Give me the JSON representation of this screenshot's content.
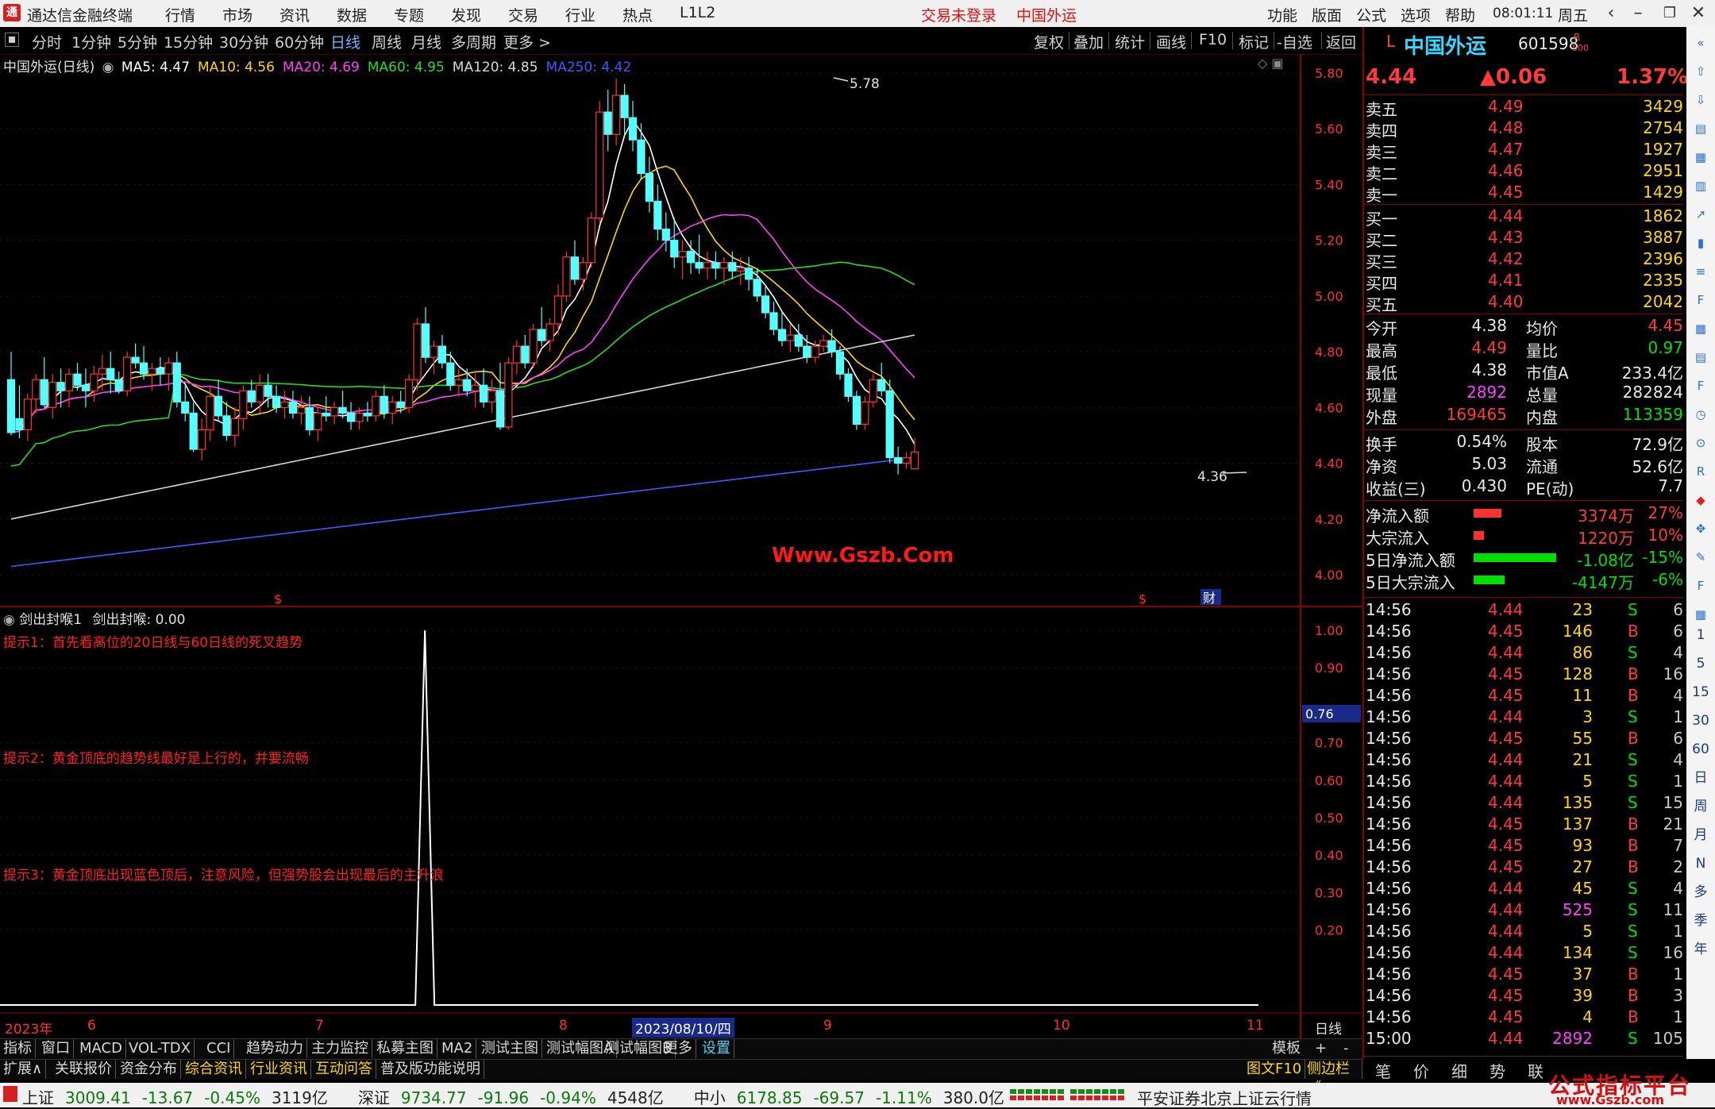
{
  "app": {
    "title": "通达信金融终端",
    "menu": [
      "行情",
      "市场",
      "资讯",
      "数据",
      "专题",
      "发现",
      "交易",
      "行业",
      "热点",
      "L1L2"
    ],
    "login_status": "交易未登录",
    "stock_title": "中国外运",
    "right_menu": [
      "功能",
      "版面",
      "公式",
      "选项",
      "帮助"
    ],
    "clock": "08:01:11",
    "weekday": "周五"
  },
  "period_bar": {
    "items": [
      "分时",
      "1分钟",
      "5分钟",
      "15分钟",
      "30分钟",
      "60分钟",
      "日线",
      "周线",
      "月线",
      "多周期",
      "更多 >"
    ],
    "selected": "日线",
    "tools": [
      "复权",
      "叠加",
      "统计",
      "画线",
      "F10",
      "标记",
      "-自选",
      "返回"
    ]
  },
  "chart_header": {
    "name": "中国外运(日线)",
    "ma": [
      {
        "label": "MA5: 4.47",
        "color": "#ffffff"
      },
      {
        "label": "MA10: 4.56",
        "color": "#ffd800"
      },
      {
        "label": "MA20: 4.69",
        "color": "#ff40ff"
      },
      {
        "label": "MA60: 4.95",
        "color": "#22dd22"
      },
      {
        "label": "MA120: 4.85",
        "color": "#d8d8d8"
      },
      {
        "label": "MA250: 4.42",
        "color": "#3c5cff"
      }
    ],
    "high_marker": "5.78",
    "low_marker": "4.36",
    "watermark": "Www.Gszb.Com",
    "markers": [
      "$",
      "$",
      "财"
    ]
  },
  "price_axis": [
    "5.80",
    "5.60",
    "5.40",
    "5.20",
    "5.00",
    "4.80",
    "4.60",
    "4.40",
    "4.20",
    "4.00"
  ],
  "indicator": {
    "name": "剑出封喉1",
    "value_label": "剑出封喉: 0.00",
    "axis": [
      "1.00",
      "0.90",
      "0.70",
      "0.60",
      "0.50",
      "0.40",
      "0.30",
      "0.20"
    ],
    "current_tag": "0.76",
    "hints": [
      "提示1：首先看高位的20日线与60日线的死叉趋势",
      "提示2：黄金顶底的趋势线最好是上行的，并要流畅",
      "提示3：黄金顶底出现蓝色顶后，注意风险，但强势股会出现最后的主升浪"
    ]
  },
  "date_axis": {
    "labels": [
      "2023年",
      "6",
      "7",
      "8",
      "9",
      "10",
      "11"
    ],
    "cursor": "2023/08/10/四",
    "period": "日线"
  },
  "bottom_tabs": [
    "指标",
    "窗口",
    "MACD",
    "VOL-TDX",
    "CCI",
    "趋势动力",
    "主力监控",
    "私募主图",
    "MA2",
    "测试主图",
    "测试幅图A",
    "测试幅图B",
    "更多",
    "设置"
  ],
  "bottom_tabs_right": [
    "模板",
    "+",
    "-"
  ],
  "bottom_links": [
    {
      "label": "扩展∧",
      "color": "#d8d8d8"
    },
    {
      "label": "关联报价",
      "color": "#d8d8d8"
    },
    {
      "label": "资金分布",
      "color": "#d8d8d8"
    },
    {
      "label": "综合资讯",
      "color": "#ffd800"
    },
    {
      "label": "行业资讯",
      "color": "#ffd800"
    },
    {
      "label": "互动问答",
      "color": "#ffd800"
    },
    {
      "label": "普及版功能说明",
      "color": "#d8d8d8"
    }
  ],
  "bottom_right_links": [
    "图文F10",
    "侧边栏 《"
  ],
  "quote": {
    "code_prefix": "L",
    "name": "中国外运",
    "code": "601598",
    "code_suffix": "R",
    "code_sub": "500",
    "price": "4.44",
    "change": "▲0.06",
    "change_pct": "1.37%",
    "asks": [
      {
        "label": "卖五",
        "price": "4.49",
        "vol": "3429"
      },
      {
        "label": "卖四",
        "price": "4.48",
        "vol": "2754"
      },
      {
        "label": "卖三",
        "price": "4.47",
        "vol": "1927"
      },
      {
        "label": "卖二",
        "price": "4.46",
        "vol": "2951"
      },
      {
        "label": "卖一",
        "price": "4.45",
        "vol": "1429"
      }
    ],
    "bids": [
      {
        "label": "买一",
        "price": "4.44",
        "vol": "1862"
      },
      {
        "label": "买二",
        "price": "4.43",
        "vol": "3887"
      },
      {
        "label": "买三",
        "price": "4.42",
        "vol": "2396"
      },
      {
        "label": "买四",
        "price": "4.41",
        "vol": "2335"
      },
      {
        "label": "买五",
        "price": "4.40",
        "vol": "2042"
      }
    ],
    "stats": [
      {
        "l1": "今开",
        "v1": "4.38",
        "c1": "#e8e8e8",
        "l2": "均价",
        "v2": "4.45",
        "c2": "#ff3b3b"
      },
      {
        "l1": "最高",
        "v1": "4.49",
        "c1": "#ff3b3b",
        "l2": "量比",
        "v2": "0.97",
        "c2": "#00e000"
      },
      {
        "l1": "最低",
        "v1": "4.38",
        "c1": "#e8e8e8",
        "l2": "市值A",
        "v2": "233.4亿",
        "c2": "#e8e8e8"
      },
      {
        "l1": "现量",
        "v1": "2892",
        "c1": "#ff40ff",
        "l2": "总量",
        "v2": "282824",
        "c2": "#e8e8e8"
      },
      {
        "l1": "外盘",
        "v1": "169465",
        "c1": "#ff3b3b",
        "l2": "内盘",
        "v2": "113359",
        "c2": "#00e000"
      }
    ],
    "stats2": [
      {
        "l1": "换手",
        "v1": "0.54%",
        "l2": "股本",
        "v2": "72.9亿"
      },
      {
        "l1": "净资",
        "v1": "5.03",
        "l2": "流通",
        "v2": "52.6亿"
      },
      {
        "l1": "收益(三)",
        "v1": "0.430",
        "l2": "PE(动)",
        "v2": "7.7"
      }
    ],
    "flows": [
      {
        "label": "净流入额",
        "bar_color": "#ff3030",
        "bar_frac": 0.27,
        "value": "3374万",
        "pct": "27%",
        "color": "#ff3b3b"
      },
      {
        "label": "大宗流入",
        "bar_color": "#ff3030",
        "bar_frac": 0.1,
        "value": "1220万",
        "pct": "10%",
        "color": "#ff3b3b"
      },
      {
        "label": "5日净流入额",
        "bar_color": "#00e000",
        "bar_frac": 0.8,
        "value": "-1.08亿",
        "pct": "-15%",
        "color": "#00e000"
      },
      {
        "label": "5日大宗流入",
        "bar_color": "#00e000",
        "bar_frac": 0.3,
        "value": "-4147万",
        "pct": "-6%",
        "color": "#00e000"
      }
    ],
    "ticks": [
      {
        "t": "14:56",
        "p": "4.44",
        "v": "23",
        "d": "S",
        "n": "6"
      },
      {
        "t": "14:56",
        "p": "4.45",
        "v": "146",
        "d": "B",
        "n": "6"
      },
      {
        "t": "14:56",
        "p": "4.44",
        "v": "86",
        "d": "S",
        "n": "4"
      },
      {
        "t": "14:56",
        "p": "4.45",
        "v": "128",
        "d": "B",
        "n": "16"
      },
      {
        "t": "14:56",
        "p": "4.45",
        "v": "11",
        "d": "B",
        "n": "4"
      },
      {
        "t": "14:56",
        "p": "4.44",
        "v": "3",
        "d": "S",
        "n": "1"
      },
      {
        "t": "14:56",
        "p": "4.45",
        "v": "55",
        "d": "B",
        "n": "6"
      },
      {
        "t": "14:56",
        "p": "4.44",
        "v": "21",
        "d": "S",
        "n": "4"
      },
      {
        "t": "14:56",
        "p": "4.44",
        "v": "5",
        "d": "S",
        "n": "1"
      },
      {
        "t": "14:56",
        "p": "4.44",
        "v": "135",
        "d": "S",
        "n": "15"
      },
      {
        "t": "14:56",
        "p": "4.45",
        "v": "137",
        "d": "B",
        "n": "21"
      },
      {
        "t": "14:56",
        "p": "4.45",
        "v": "93",
        "d": "B",
        "n": "7"
      },
      {
        "t": "14:56",
        "p": "4.45",
        "v": "27",
        "d": "B",
        "n": "2"
      },
      {
        "t": "14:56",
        "p": "4.44",
        "v": "45",
        "d": "S",
        "n": "4"
      },
      {
        "t": "14:56",
        "p": "4.44",
        "v": "525",
        "d": "S",
        "n": "11"
      },
      {
        "t": "14:56",
        "p": "4.44",
        "v": "5",
        "d": "S",
        "n": "1"
      },
      {
        "t": "14:56",
        "p": "4.44",
        "v": "134",
        "d": "S",
        "n": "16"
      },
      {
        "t": "14:56",
        "p": "4.45",
        "v": "37",
        "d": "B",
        "n": "1"
      },
      {
        "t": "14:56",
        "p": "4.45",
        "v": "39",
        "d": "B",
        "n": "3"
      },
      {
        "t": "14:56",
        "p": "4.45",
        "v": "4",
        "d": "B",
        "n": "1"
      },
      {
        "t": "15:00",
        "p": "4.44",
        "v": "2892",
        "d": "S",
        "n": "105"
      }
    ],
    "bottom_tabs": [
      "笔",
      "价",
      "细",
      "势",
      "联"
    ]
  },
  "sidebar_icons": [
    "collapse-icon",
    "up-arrow-icon",
    "down-arrow-icon",
    "chart-icon",
    "grid-icon",
    "table-icon",
    "line-icon",
    "candles-icon",
    "list-icon",
    "fundamentals-icon",
    "sheet-icon",
    "doc-icon",
    "f-icon",
    "clock-icon",
    "meter-icon",
    "rsi-icon",
    "fire-icon",
    "move-icon",
    "pen-icon",
    "f5-icon",
    "sheet2-icon"
  ],
  "sidebar_labels": [
    "1",
    "5",
    "15",
    "30",
    "60",
    "日",
    "周",
    "月",
    "N",
    "多",
    "季",
    "年"
  ],
  "statusbar": {
    "indices": [
      {
        "name": "上证",
        "value": "3009.41",
        "chg": "-13.67",
        "pct": "-0.45%",
        "amt": "3119亿"
      },
      {
        "name": "深证",
        "value": "9734.77",
        "chg": "-91.96",
        "pct": "-0.94%",
        "amt": "4548亿"
      },
      {
        "name": "中小",
        "value": "6178.85",
        "chg": "-69.57",
        "pct": "-1.11%",
        "amt": "380.0亿"
      }
    ],
    "broker": "平安证券北京上证云行情",
    "brand": "公式指标平台",
    "brand_url": "www.Gszb.com"
  },
  "chart_data": {
    "type": "candlestick",
    "title": "中国外运(日线)",
    "ylim": [
      4.0,
      5.82
    ],
    "x_labels": [
      "2023年",
      "6",
      "7",
      "8",
      "9",
      "10",
      "11"
    ],
    "candles": [
      [
        4.7,
        4.8,
        4.5,
        4.51
      ],
      [
        4.56,
        4.68,
        4.49,
        4.52
      ],
      [
        4.52,
        4.65,
        4.48,
        4.63
      ],
      [
        4.63,
        4.72,
        4.58,
        4.7
      ],
      [
        4.7,
        4.78,
        4.6,
        4.61
      ],
      [
        4.6,
        4.72,
        4.56,
        4.69
      ],
      [
        4.69,
        4.74,
        4.6,
        4.66
      ],
      [
        4.66,
        4.74,
        4.6,
        4.72
      ],
      [
        4.72,
        4.76,
        4.66,
        4.68
      ],
      [
        4.68,
        4.74,
        4.6,
        4.66
      ],
      [
        4.66,
        4.75,
        4.62,
        4.72
      ],
      [
        4.72,
        4.79,
        4.66,
        4.74
      ],
      [
        4.74,
        4.8,
        4.65,
        4.7
      ],
      [
        4.7,
        4.73,
        4.65,
        4.66
      ],
      [
        4.66,
        4.8,
        4.64,
        4.78
      ],
      [
        4.78,
        4.83,
        4.74,
        4.76
      ],
      [
        4.76,
        4.82,
        4.7,
        4.72
      ],
      [
        4.72,
        4.76,
        4.66,
        4.74
      ],
      [
        4.74,
        4.78,
        4.68,
        4.72
      ],
      [
        4.72,
        4.78,
        4.66,
        4.76
      ],
      [
        4.76,
        4.8,
        4.6,
        4.62
      ],
      [
        4.62,
        4.68,
        4.55,
        4.58
      ],
      [
        4.58,
        4.62,
        4.44,
        4.45
      ],
      [
        4.45,
        4.56,
        4.41,
        4.52
      ],
      [
        4.52,
        4.68,
        4.48,
        4.64
      ],
      [
        4.64,
        4.7,
        4.55,
        4.57
      ],
      [
        4.57,
        4.62,
        4.48,
        4.5
      ],
      [
        4.5,
        4.6,
        4.46,
        4.56
      ],
      [
        4.56,
        4.68,
        4.52,
        4.66
      ],
      [
        4.66,
        4.7,
        4.6,
        4.62
      ],
      [
        4.62,
        4.72,
        4.58,
        4.68
      ],
      [
        4.68,
        4.72,
        4.6,
        4.64
      ],
      [
        4.64,
        4.68,
        4.58,
        4.6
      ],
      [
        4.6,
        4.66,
        4.56,
        4.62
      ],
      [
        4.62,
        4.66,
        4.56,
        4.58
      ],
      [
        4.58,
        4.64,
        4.54,
        4.6
      ],
      [
        4.6,
        4.64,
        4.5,
        4.52
      ],
      [
        4.52,
        4.6,
        4.48,
        4.58
      ],
      [
        4.58,
        4.64,
        4.55,
        4.57
      ],
      [
        4.57,
        4.62,
        4.54,
        4.6
      ],
      [
        4.6,
        4.66,
        4.56,
        4.58
      ],
      [
        4.58,
        4.62,
        4.52,
        4.55
      ],
      [
        4.55,
        4.6,
        4.52,
        4.58
      ],
      [
        4.58,
        4.62,
        4.55,
        4.57
      ],
      [
        4.57,
        4.66,
        4.55,
        4.64
      ],
      [
        4.64,
        4.68,
        4.56,
        4.58
      ],
      [
        4.58,
        4.64,
        4.54,
        4.62
      ],
      [
        4.62,
        4.66,
        4.58,
        4.6
      ],
      [
        4.6,
        4.72,
        4.58,
        4.7
      ],
      [
        4.7,
        4.92,
        4.66,
        4.9
      ],
      [
        4.9,
        4.96,
        4.76,
        4.78
      ],
      [
        4.78,
        4.84,
        4.72,
        4.82
      ],
      [
        4.82,
        4.86,
        4.74,
        4.76
      ],
      [
        4.76,
        4.8,
        4.66,
        4.68
      ],
      [
        4.68,
        4.74,
        4.64,
        4.7
      ],
      [
        4.7,
        4.74,
        4.64,
        4.66
      ],
      [
        4.66,
        4.72,
        4.6,
        4.68
      ],
      [
        4.68,
        4.74,
        4.6,
        4.62
      ],
      [
        4.62,
        4.7,
        4.58,
        4.66
      ],
      [
        4.66,
        4.76,
        4.52,
        4.53
      ],
      [
        4.53,
        4.78,
        4.52,
        4.76
      ],
      [
        4.76,
        4.84,
        4.72,
        4.82
      ],
      [
        4.82,
        4.86,
        4.74,
        4.76
      ],
      [
        4.76,
        4.9,
        4.74,
        4.88
      ],
      [
        4.88,
        4.96,
        4.82,
        4.84
      ],
      [
        4.84,
        4.92,
        4.8,
        4.9
      ],
      [
        4.9,
        5.04,
        4.86,
        5.0
      ],
      [
        5.0,
        5.16,
        4.98,
        5.14
      ],
      [
        5.14,
        5.2,
        5.04,
        5.06
      ],
      [
        5.06,
        5.14,
        5.02,
        5.12
      ],
      [
        5.12,
        5.3,
        5.1,
        5.28
      ],
      [
        5.28,
        5.7,
        5.26,
        5.66
      ],
      [
        5.66,
        5.74,
        5.52,
        5.58
      ],
      [
        5.58,
        5.78,
        5.54,
        5.72
      ],
      [
        5.72,
        5.76,
        5.58,
        5.64
      ],
      [
        5.64,
        5.7,
        5.52,
        5.56
      ],
      [
        5.56,
        5.62,
        5.42,
        5.44
      ],
      [
        5.44,
        5.5,
        5.3,
        5.34
      ],
      [
        5.34,
        5.4,
        5.2,
        5.24
      ],
      [
        5.24,
        5.3,
        5.16,
        5.2
      ],
      [
        5.2,
        5.28,
        5.1,
        5.14
      ],
      [
        5.14,
        5.2,
        5.06,
        5.16
      ],
      [
        5.16,
        5.2,
        5.08,
        5.12
      ],
      [
        5.12,
        5.22,
        5.08,
        5.1
      ],
      [
        5.1,
        5.16,
        5.06,
        5.12
      ],
      [
        5.12,
        5.16,
        5.06,
        5.1
      ],
      [
        5.1,
        5.14,
        5.04,
        5.12
      ],
      [
        5.12,
        5.16,
        5.06,
        5.09
      ],
      [
        5.09,
        5.14,
        5.04,
        5.1
      ],
      [
        5.1,
        5.14,
        5.02,
        5.06
      ],
      [
        5.06,
        5.1,
        4.98,
        5.0
      ],
      [
        5.0,
        5.04,
        4.92,
        4.94
      ],
      [
        4.94,
        4.98,
        4.86,
        4.88
      ],
      [
        4.88,
        4.94,
        4.82,
        4.84
      ],
      [
        4.84,
        4.9,
        4.8,
        4.86
      ],
      [
        4.86,
        4.9,
        4.8,
        4.82
      ],
      [
        4.82,
        4.86,
        4.76,
        4.78
      ],
      [
        4.78,
        4.84,
        4.76,
        4.82
      ],
      [
        4.82,
        4.86,
        4.8,
        4.84
      ],
      [
        4.84,
        4.88,
        4.78,
        4.8
      ],
      [
        4.8,
        4.82,
        4.7,
        4.72
      ],
      [
        4.72,
        4.74,
        4.62,
        4.64
      ],
      [
        4.64,
        4.66,
        4.52,
        4.54
      ],
      [
        4.54,
        4.64,
        4.52,
        4.62
      ],
      [
        4.62,
        4.72,
        4.6,
        4.7
      ],
      [
        4.7,
        4.76,
        4.64,
        4.66
      ],
      [
        4.66,
        4.7,
        4.4,
        4.42
      ],
      [
        4.42,
        4.46,
        4.36,
        4.4
      ],
      [
        4.4,
        4.44,
        4.38,
        4.42
      ],
      [
        4.38,
        4.49,
        4.38,
        4.44
      ]
    ],
    "indicator_spike": {
      "index": 48,
      "value": 1.0
    }
  }
}
